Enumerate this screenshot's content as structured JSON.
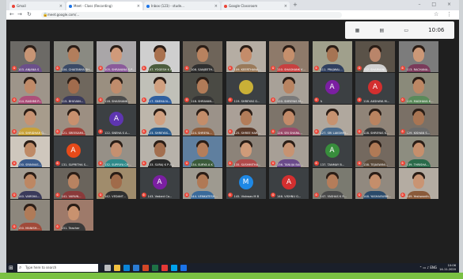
{
  "browser": {
    "tabs": [
      {
        "label": "Gmail",
        "active": false
      },
      {
        "label": "Meet - Class (Recording)",
        "active": true
      },
      {
        "label": "Inbox (123) - stude...",
        "active": false
      },
      {
        "label": "Google Classroom",
        "active": false
      }
    ],
    "new_tab": "+",
    "window_controls": "– □ ×",
    "address": "meet.google.com/..."
  },
  "meet_bar": {
    "time": "10:06"
  },
  "participants": [
    {
      "name": "103. ANJANA S",
      "type": "video",
      "skin": "#c79575",
      "shirt": "#6b4f8a",
      "bg": "#6c6a66"
    },
    {
      "name": "104. CHAITANYA SH...",
      "type": "video",
      "skin": "#b27e5c",
      "shirt": "#3a4a66",
      "bg": "#8a8a82"
    },
    {
      "name": "105. SHRAVANA S.P...",
      "type": "video",
      "skin": "#d09a7a",
      "shirt": "#8a5a9a",
      "bg": "#a9a6a8"
    },
    {
      "name": "107. YOGESH K P...",
      "type": "video",
      "skin": "#a9714e",
      "shirt": "#4b5c3c",
      "bg": "#cfcfcf"
    },
    {
      "name": "108. SANJEETH...",
      "type": "video",
      "skin": "#b8825f",
      "shirt": "#2f2f2f",
      "bg": "#6e6459"
    },
    {
      "name": "109. KEERTHANA...",
      "type": "video",
      "skin": "#c48c6a",
      "shirt": "#9a7a5a",
      "bg": "#b5ada3"
    },
    {
      "name": "110. SHASHANK K...",
      "type": "video",
      "skin": "#c58f6c",
      "shirt": "#c84040",
      "bg": "#8e7a6a"
    },
    {
      "name": "111. PRAJWAL...",
      "type": "video",
      "skin": "#a67453",
      "shirt": "#2f3f5f",
      "bg": "#a0a08c"
    },
    {
      "name": "112. SHARVANI...",
      "type": "video",
      "skin": "#b9856a",
      "shirt": "#d0d0d0",
      "bg": "#5a5248"
    },
    {
      "name": "113. RACHANA...",
      "type": "video",
      "skin": "#cc9877",
      "shirt": "#7a3a5a",
      "bg": "#7c7c7c"
    },
    {
      "name": "114. RASHMI P...",
      "type": "video",
      "skin": "#bf8a68",
      "shirt": "#ad4f7a",
      "bg": "#9e958a"
    },
    {
      "name": "115. BHUVAN...",
      "type": "video",
      "skin": "#a16c4d",
      "shirt": "#3c3c5c",
      "bg": "#6f675d"
    },
    {
      "name": "116. SHASHANK...",
      "type": "video",
      "skin": "#c08c6c",
      "shirt": "#4a4a4a",
      "bg": "#9a8f80"
    },
    {
      "name": "117. SNEHA N...",
      "type": "video",
      "skin": "#d0a080",
      "shirt": "#2f5f9f",
      "bg": "#c0c0b8"
    },
    {
      "name": "118. SHRAVAN...",
      "type": "video",
      "skin": "#b17b58",
      "shirt": "#333333",
      "bg": "#4a4a44"
    },
    {
      "name": "119. SHREYAS G...",
      "type": "avatar",
      "letter": "",
      "color": "#c9b037"
    },
    {
      "name": "120. SHREYAS M...",
      "type": "video",
      "skin": "#b88462",
      "shirt": "#7a7a7a",
      "bg": "#a8a198"
    },
    {
      "name": "A",
      "type": "avatar",
      "letter": "A",
      "color": "#7b1fa2"
    },
    {
      "name": "118. AKSHAYA M...",
      "type": "avatar",
      "letter": "A",
      "color": "#d32f2f"
    },
    {
      "name": "119. MADHAVA K...",
      "type": "video",
      "skin": "#bc8764",
      "shirt": "#5a8a5a",
      "bg": "#8a8a7a"
    },
    {
      "name": "120. SHRIDHAR G...",
      "type": "video",
      "skin": "#c69373",
      "shirt": "#c8a23a",
      "bg": "#a79c8c"
    },
    {
      "name": "121. SREESAMI...",
      "type": "video",
      "skin": "#c8906e",
      "shirt": "#a0403a",
      "bg": "#9c8f82"
    },
    {
      "name": "122. SNEHA S A...",
      "type": "avatar",
      "letter": "A",
      "color": "#5e35b1"
    },
    {
      "name": "123. SHREYAS...",
      "type": "video",
      "skin": "#d0a080",
      "shirt": "#2c5c8c",
      "bg": "#bdb6ab"
    },
    {
      "name": "124. SHREYA...",
      "type": "video",
      "skin": "#c38d6a",
      "shirt": "#8c5c3c",
      "bg": "#9b9289"
    },
    {
      "name": "125. SHREE HAR...",
      "type": "video",
      "skin": "#b27c59",
      "shirt": "#5a3a2a",
      "bg": "#aaa097"
    },
    {
      "name": "126. SRI SHARA...",
      "type": "video",
      "skin": "#c38b69",
      "shirt": "#9a4a6a",
      "bg": "#7d746a"
    },
    {
      "name": "127. SRI LAKSHMI...",
      "type": "video",
      "skin": "#c69270",
      "shirt": "#4a6a8a",
      "bg": "#b0a89e"
    },
    {
      "name": "128. SHREYAS K...",
      "type": "video",
      "skin": "#b98360",
      "shirt": "#3a3a3a",
      "bg": "#908478"
    },
    {
      "name": "129. KISHAN S...",
      "type": "video",
      "skin": "#a97553",
      "shirt": "#6a6a6a",
      "bg": "#7a7066"
    },
    {
      "name": "130. SRINIVAS...",
      "type": "video",
      "skin": "#bf8a66",
      "shirt": "#3a5a8a",
      "bg": "#cfc7bd"
    },
    {
      "name": "131. SUPRITHA S...",
      "type": "avatar",
      "letter": "A",
      "color": "#e64a19"
    },
    {
      "name": "132. SUPRIYA CH...",
      "type": "video",
      "skin": "#c59070",
      "shirt": "#2f8a8a",
      "bg": "#969087"
    },
    {
      "name": "133. SURAJ K P A...",
      "type": "video",
      "skin": "#a36f4f",
      "shirt": "#2a2a2a",
      "bg": "#b7b2aa"
    },
    {
      "name": "134. SURYA A K",
      "type": "video",
      "skin": "#b47e5b",
      "shirt": "#3a5a3a",
      "bg": "#5f7f9f"
    },
    {
      "name": "135. SUSHMITHA...",
      "type": "video",
      "skin": "#cf9b79",
      "shirt": "#b04a4a",
      "bg": "#8c8379"
    },
    {
      "name": "136. TANUJA BAI...",
      "type": "video",
      "skin": "#c79372",
      "shirt": "#6a4a8a",
      "bg": "#a79f96"
    },
    {
      "name": "137. TANMAY B...",
      "type": "avatar",
      "letter": "A",
      "color": "#388e3c"
    },
    {
      "name": "138. TEJASWINI...",
      "type": "video",
      "skin": "#b07a56",
      "shirt": "#5a4a3a",
      "bg": "#74695f"
    },
    {
      "name": "139. THRISHA...",
      "type": "video",
      "skin": "#c68f6c",
      "shirt": "#2a6a4a",
      "bg": "#8d8d80"
    },
    {
      "name": "140. VARSHA...",
      "type": "video",
      "skin": "#bd8763",
      "shirt": "#3a3a5a",
      "bg": "#a39d93"
    },
    {
      "name": "141. VARUN...",
      "type": "video",
      "skin": "#b88361",
      "shirt": "#8a3a3a",
      "bg": "#6a645c"
    },
    {
      "name": "142. VEDANT...",
      "type": "video",
      "skin": "#a06b4a",
      "shirt": "#2f2f2f",
      "bg": "#a08c6c"
    },
    {
      "name": "143. Vedant Co...",
      "type": "avatar",
      "letter": "A",
      "color": "#7b1fa2"
    },
    {
      "name": "144. VENKATESH...",
      "type": "video",
      "skin": "#b07955",
      "shirt": "#3a6a9a",
      "bg": "#9e9a90"
    },
    {
      "name": "145. Vishwas M B",
      "type": "avatar",
      "letter": "M",
      "color": "#1e88e5"
    },
    {
      "name": "146. VISHNU G...",
      "type": "avatar",
      "letter": "A",
      "color": "#d32f2f"
    },
    {
      "name": "147. YASHAS K R...",
      "type": "video",
      "skin": "#b47d5a",
      "shirt": "#4a4a4a",
      "bg": "#7a7a70"
    },
    {
      "name": "148. YASHASWINI...",
      "type": "video",
      "skin": "#c48e6b",
      "shirt": "#2a4a6a",
      "bg": "#91897f"
    },
    {
      "name": "149. Yeshwanth...",
      "type": "video",
      "skin": "#c99473",
      "shirt": "#8a5a3a",
      "bg": "#b4aca2"
    },
    {
      "name": "150. MANISH...",
      "type": "video",
      "skin": "#b07b58",
      "shirt": "#a04a3a",
      "bg": "#8d877d"
    },
    {
      "name": "151. Teacher",
      "type": "video",
      "skin": "#c9926f",
      "shirt": "#3a3a3a",
      "bg": "#9e7a6a"
    }
  ],
  "taskbar": {
    "search_placeholder": "Type here to search",
    "tray_time": "10:06",
    "tray_date": "14-11-2020",
    "tray_lang": "ENG"
  },
  "colors": {
    "mic_off": "#ea4335",
    "taskbar": "#1a1f2a",
    "grid_bg": "#1f1f1f"
  }
}
